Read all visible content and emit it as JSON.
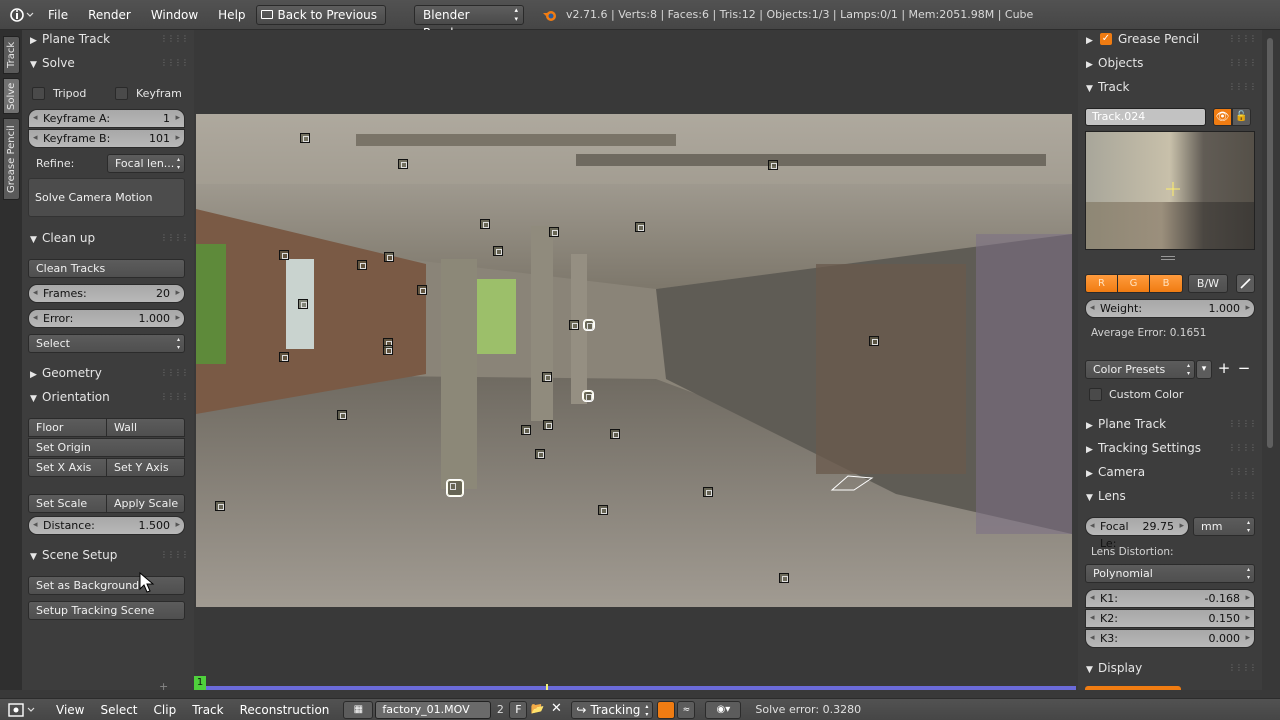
{
  "topbar": {
    "menus": [
      "File",
      "Render",
      "Window",
      "Help"
    ],
    "back_label": "Back to Previous",
    "engine": "Blender Render",
    "stats": "v2.71.6 | Verts:8 | Faces:6 | Tris:12 | Objects:1/3 | Lamps:0/1 | Mem:2051.98M | Cube"
  },
  "tool_tabs": [
    "Track",
    "Solve",
    "Grease Pencil"
  ],
  "left": {
    "plane_track": "Plane Track",
    "solve": {
      "title": "Solve",
      "tripod": "Tripod",
      "keyframe": "Keyfram",
      "keyframe_a_label": "Keyframe A:",
      "keyframe_a": "1",
      "keyframe_b_label": "Keyframe B:",
      "keyframe_b": "101",
      "refine_label": "Refine:",
      "refine": "Focal len...",
      "solve_button": "Solve Camera Motion"
    },
    "cleanup": {
      "title": "Clean up",
      "clean_tracks": "Clean Tracks",
      "frames_label": "Frames:",
      "frames": "20",
      "error_label": "Error:",
      "error": "1.000",
      "select": "Select"
    },
    "geometry": "Geometry",
    "orientation": {
      "title": "Orientation",
      "floor": "Floor",
      "wall": "Wall",
      "set_origin": "Set Origin",
      "set_x": "Set X Axis",
      "set_y": "Set Y Axis",
      "set_scale": "Set Scale",
      "apply_scale": "Apply Scale",
      "distance_label": "Distance:",
      "distance": "1.500"
    },
    "scene_setup": {
      "title": "Scene Setup",
      "set_background": "Set as Background",
      "setup_scene": "Setup Tracking Scene"
    }
  },
  "right": {
    "grease_pencil": "Grease Pencil",
    "objects": "Objects",
    "track": {
      "title": "Track",
      "name": "Track.024",
      "r": "R",
      "g": "G",
      "b": "B",
      "bw": "B/W",
      "weight_label": "Weight:",
      "weight": "1.000",
      "avg_error": "Average Error: 0.1651",
      "color_presets": "Color Presets",
      "custom_color": "Custom Color"
    },
    "plane_track": "Plane Track",
    "tracking_settings": "Tracking Settings",
    "camera": "Camera",
    "lens": {
      "title": "Lens",
      "focal_label": "Focal Le:",
      "focal": "29.75",
      "unit": "mm",
      "distortion_label": "Lens Distortion:",
      "model": "Polynomial",
      "k1_label": "K1:",
      "k1": "-0.168",
      "k2_label": "K2:",
      "k2": "0.150",
      "k3_label": "K3:",
      "k3": "0.000"
    },
    "display": "Display"
  },
  "timeline": {
    "frame": "1"
  },
  "bottombar": {
    "menus": [
      "View",
      "Select",
      "Clip",
      "Track",
      "Reconstruction"
    ],
    "clip_name": "factory_01.MOV",
    "users": "2",
    "fake": "F",
    "mode": "Tracking",
    "solve_error": "Solve error: 0.3280"
  },
  "colors": {
    "accent": "#f07c12",
    "slider": "#b3b3b3",
    "timeline": "#6b6bd9"
  }
}
